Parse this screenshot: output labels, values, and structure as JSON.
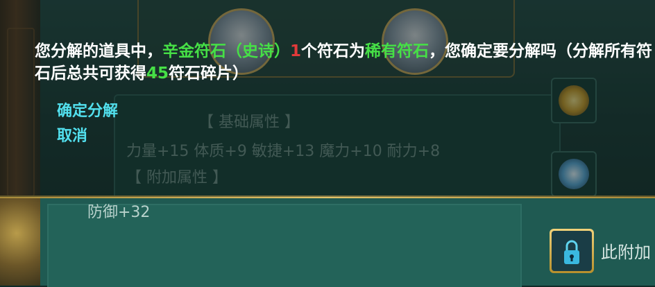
{
  "background": {
    "attributes_header_1": "【 基础属性 】",
    "attributes_line_1": "力量+15  体质+9  敏捷+13  魔力+10  耐力+8",
    "attributes_header_2": "【 附加属性 】",
    "attributes_line_2": "防御+32",
    "extra_label": "此附加"
  },
  "dialog": {
    "msg_part1": "您分解的道具中，",
    "msg_item": "辛金符石（史诗）",
    "msg_count": "1",
    "msg_part2": "个符石为",
    "msg_rarity": "稀有符石",
    "msg_part3": "，您确定要分解吗（分解所有符石后总共可获得",
    "msg_total": "45",
    "msg_part4": "符石碎片）",
    "confirm_label": "确定分解",
    "cancel_label": "取消"
  },
  "colors": {
    "highlight_green": "#46e046",
    "highlight_red": "#e23a3a",
    "option_cyan": "#52e0ee"
  }
}
